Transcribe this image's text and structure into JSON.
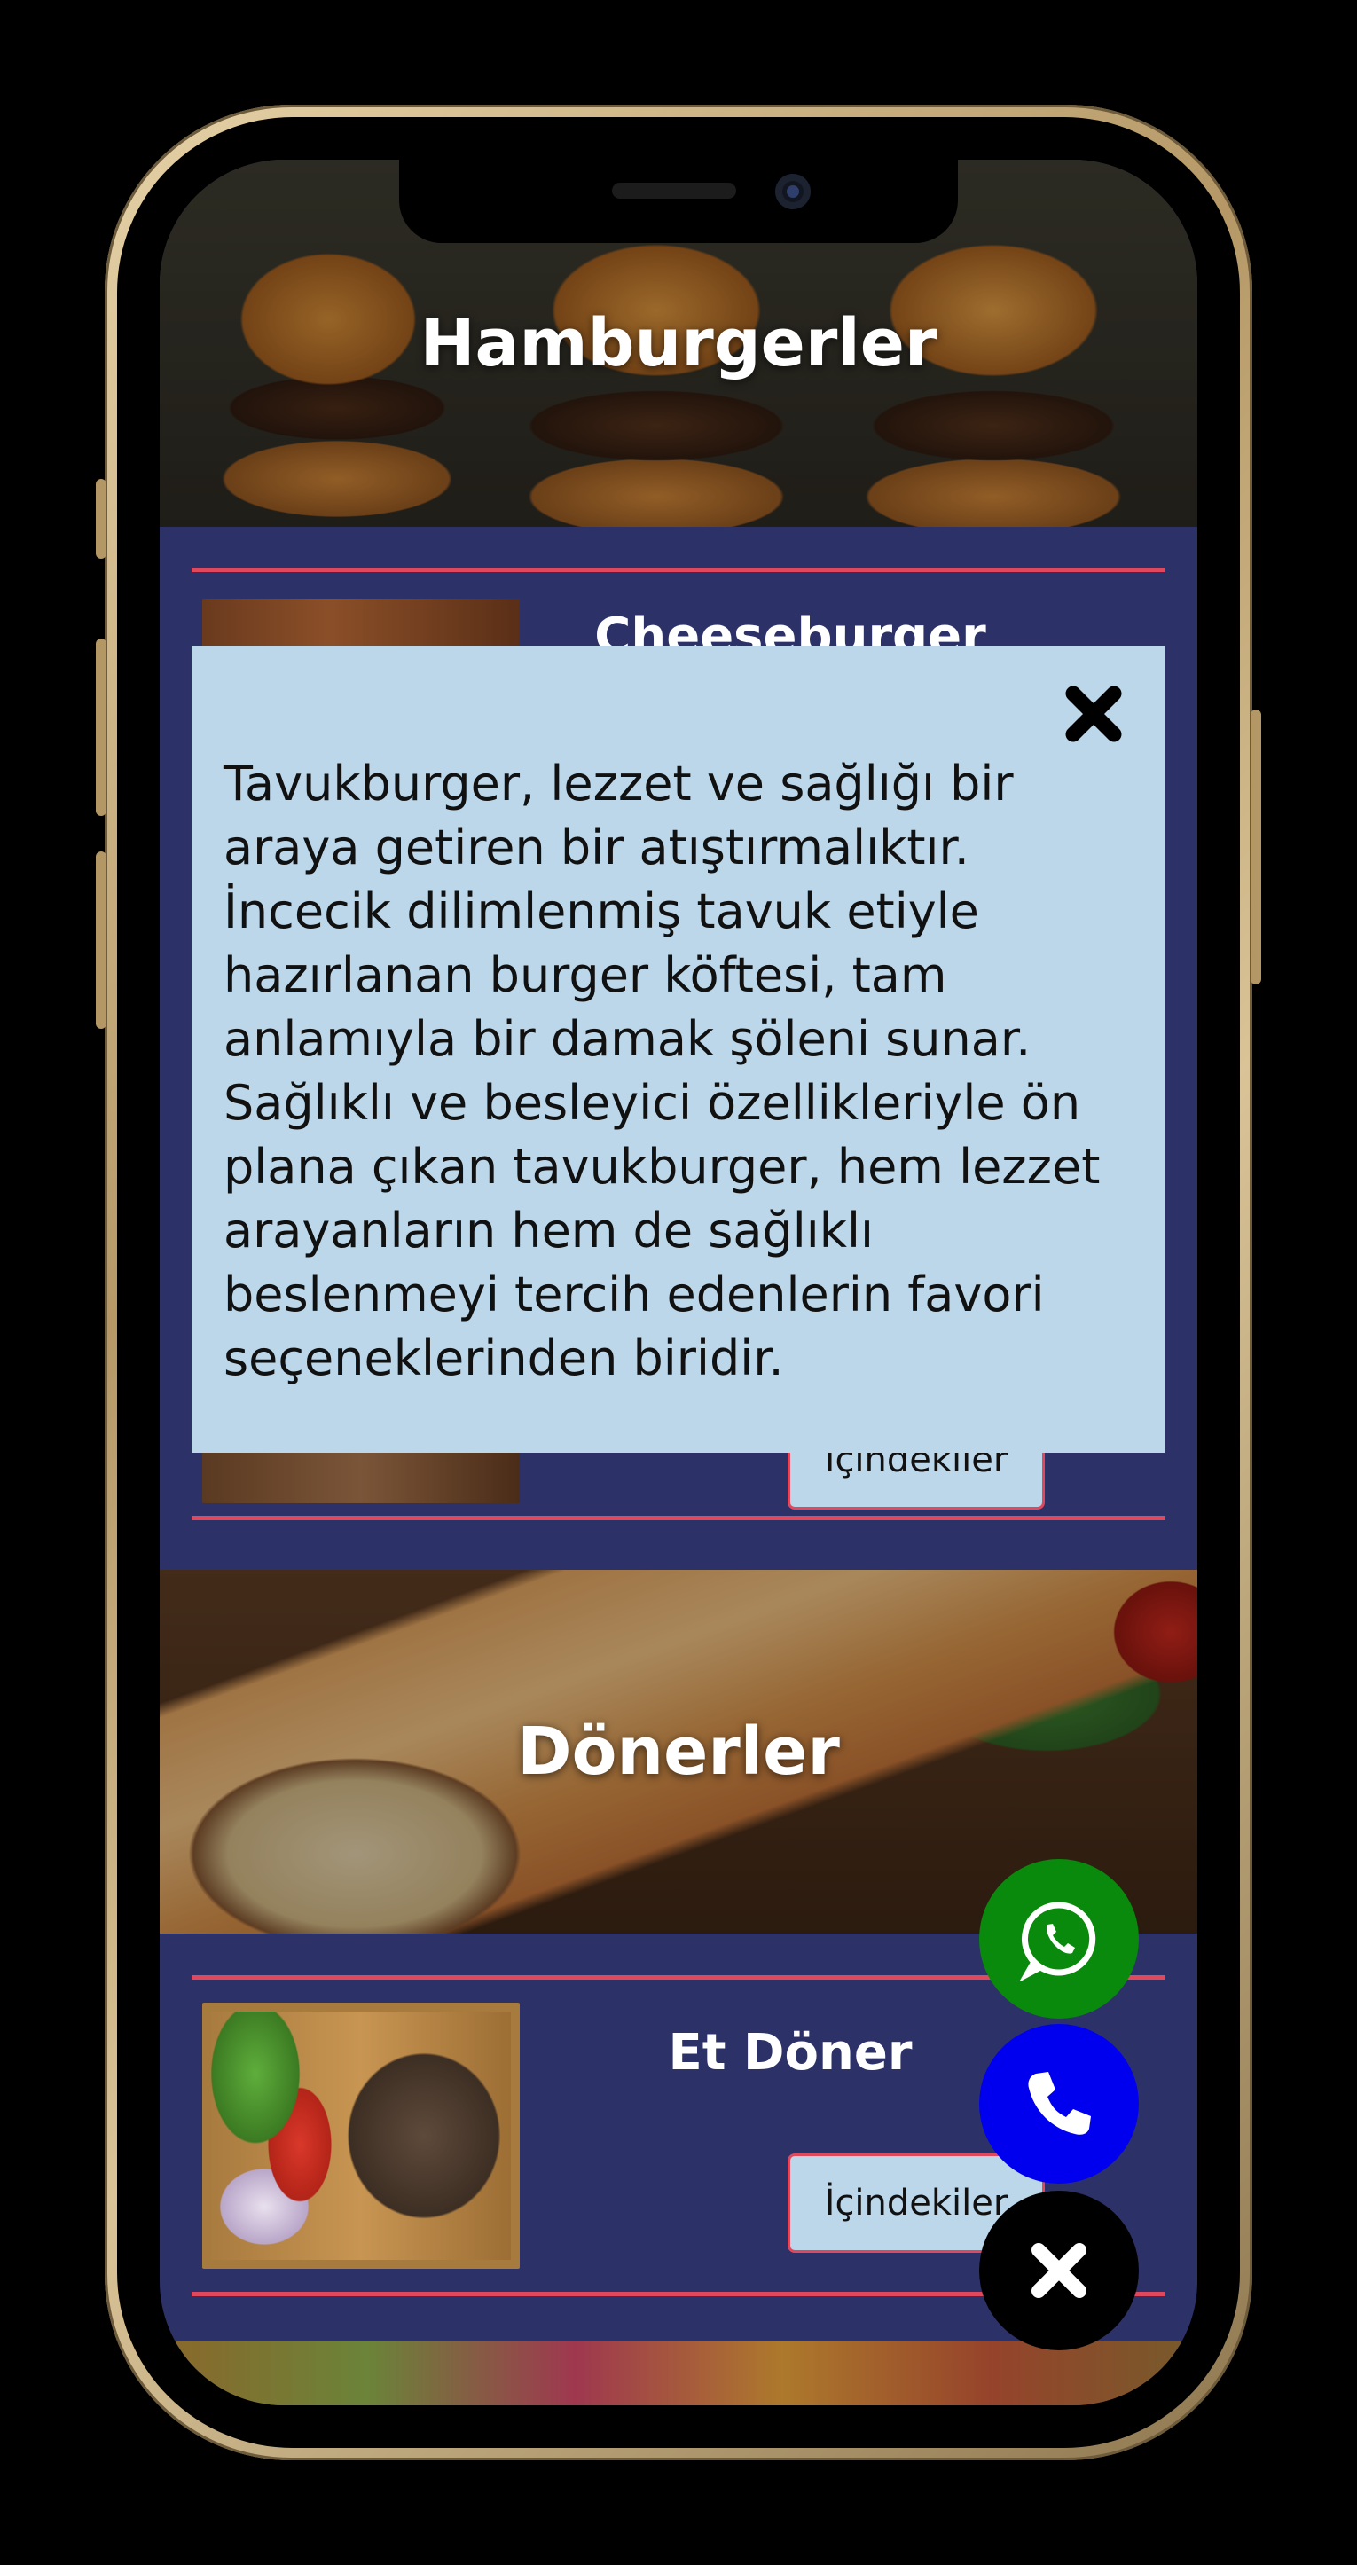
{
  "categories": [
    {
      "title": "Hamburgerler"
    },
    {
      "title": "Dönerler"
    }
  ],
  "products": {
    "burger_first": {
      "name": "Cheeseburger",
      "button_label": "İçindekiler"
    },
    "doner_first": {
      "name": "Et Döner",
      "button_label": "İçindekiler"
    }
  },
  "modal": {
    "text": "Tavukburger, lezzet ve sağlığı bir araya getiren bir atıştırmalıktır. İncecik dilimlenmiş tavuk etiyle hazırlanan burger köftesi, tam anlamıyla bir damak şöleni sunar. Sağlıklı ve besleyici özellikleriyle ön plana çıkan tavukburger, hem lezzet arayanların hem de sağlıklı beslenmeyi tercih edenlerin favori seçeneklerinden biridir.",
    "close_icon": "close-icon"
  },
  "fabs": {
    "whatsapp_icon": "whatsapp-icon",
    "phone_icon": "phone-icon",
    "close_icon": "close-icon"
  },
  "colors": {
    "background": "#2c3268",
    "accent_line": "#e0485e",
    "button_bg": "#bcd7ea",
    "whatsapp": "#0a8a0c",
    "phone": "#0000ee"
  }
}
